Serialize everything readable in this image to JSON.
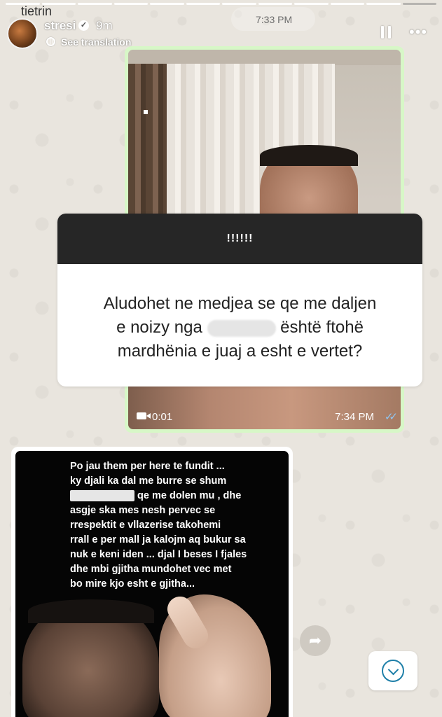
{
  "story": {
    "top_name": "tietrin",
    "top_time": "7:33 PM",
    "username": "stresi",
    "verified_icon": "verified-badge-icon",
    "posted_ago": "9m",
    "see_translation": "See translation",
    "progress_segments": 12,
    "progress_done": 11
  },
  "video_message": {
    "duration": "0:01",
    "timestamp": "7:34 PM",
    "status_icon": "double-check-icon",
    "bubble_color": "#d7f7c7"
  },
  "question_card": {
    "header": "!!!!!!",
    "line1": "Aludohet ne medjea se qe me daljen",
    "line2_start": "e noizy nga",
    "line2_end": "është ftohë",
    "line3": "mardhënia e juaj a esht e vertet?"
  },
  "reply_image": {
    "line1": "Po jau them per here te fundit ...",
    "line2": "ky djali ka dal me burre se shum",
    "line3_end": "qe me dolen mu , dhe",
    "line4": "asgje ska mes nesh pervec se",
    "line5": "rrespektit e vllazerise takohemi",
    "line6": "rrall e per mall ja kalojm aq bukur sa",
    "line7": "nuk e keni iden ... djal I beses I fjales",
    "line8": "dhe mbi gjitha mundohet vec met",
    "line9": "bo mire kjo esht e gjitha..."
  },
  "controls": {
    "pause_icon": "pause-icon",
    "more_icon": "more-icon",
    "share_icon": "share-icon",
    "scroll_icon": "chevron-down-icon"
  }
}
